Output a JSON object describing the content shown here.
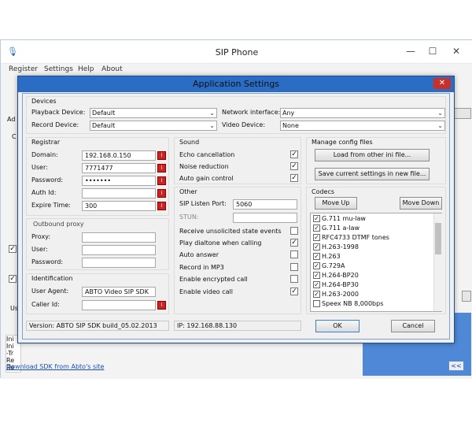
{
  "outer": {
    "title": "SIP Phone",
    "menu": [
      "Register",
      "Settings",
      "Help",
      "About"
    ],
    "min": "—",
    "max": "☐",
    "close": "✕",
    "left_fragments": [
      "Ad",
      "C",
      "Us",
      "Ini",
      "Ini",
      "-Tr",
      "Re",
      "Re"
    ],
    "download_link": "Download SDK from Abto's site",
    "collapse_btn": "<<"
  },
  "dialog": {
    "title": "Application Settings",
    "close": "✕",
    "devices": {
      "group": "Devices",
      "playback_label": "Playback Device:",
      "playback_value": "Default",
      "record_label": "Record Device:",
      "record_value": "Default",
      "network_label": "Network interface:",
      "network_value": "Any",
      "video_label": "Video Device:",
      "video_value": "None"
    },
    "registrar": {
      "group": "Registrar",
      "domain_label": "Domain:",
      "domain_value": "192.168.0.150",
      "user_label": "User:",
      "user_value": "7771477",
      "password_label": "Password:",
      "password_value": "•••••••",
      "authid_label": "Auth Id:",
      "authid_value": "",
      "expire_label": "Expire Time:",
      "expire_value": "300"
    },
    "outbound": {
      "group": "Outbound proxy",
      "proxy_label": "Proxy:",
      "user_label": "User:",
      "password_label": "Password:"
    },
    "identification": {
      "group": "Identification",
      "agent_label": "User Agent:",
      "agent_value": "ABTO Video SIP SDK",
      "callerid_label": "Caller Id:",
      "callerid_value": ""
    },
    "sound": {
      "group": "Sound",
      "items": [
        {
          "label": "Echo cancellation",
          "checked": "✓"
        },
        {
          "label": "Noise reduction",
          "checked": "✓"
        },
        {
          "label": "Auto gain control",
          "checked": "✓"
        }
      ]
    },
    "other": {
      "group": "Other",
      "port_label": "SIP Listen Port:",
      "port_value": "5060",
      "stun_label": "STUN:",
      "items": [
        {
          "label": "Receive unsolicited state events",
          "checked": ""
        },
        {
          "label": "Play dialtone when calling",
          "checked": "✓"
        },
        {
          "label": "Auto answer",
          "checked": ""
        },
        {
          "label": "Record in MP3",
          "checked": ""
        },
        {
          "label": "Enable encrypted call",
          "checked": ""
        },
        {
          "label": "Enable video call",
          "checked": "✓"
        }
      ]
    },
    "config": {
      "group": "Manage config files",
      "load_btn": "Load from other ini file...",
      "save_btn": "Save current settings in new file..."
    },
    "codecs": {
      "group": "Codecs",
      "move_up": "Move Up",
      "move_down": "Move Down",
      "items": [
        {
          "name": "G.711 mu-law",
          "checked": "✓"
        },
        {
          "name": "G.711 a-law",
          "checked": "✓"
        },
        {
          "name": "RFC4733 DTMF tones",
          "checked": "✓"
        },
        {
          "name": "H.263-1998",
          "checked": "✓"
        },
        {
          "name": "H.263",
          "checked": "✓"
        },
        {
          "name": "G.729A",
          "checked": "✓"
        },
        {
          "name": "H.264-BP20",
          "checked": "✓"
        },
        {
          "name": "H.264-BP30",
          "checked": "✓"
        },
        {
          "name": "H.263-2000",
          "checked": "✓"
        },
        {
          "name": "Speex NB   8,000bps",
          "checked": ""
        }
      ]
    },
    "ok_btn": "OK",
    "cancel_btn": "Cancel",
    "version": "Version: ABTO SIP SDK build_05.02.2013",
    "ip": "IP: 192.168.88.130"
  },
  "colors": {
    "title_bar": "#2b6cc4",
    "close": "#c8302a",
    "red_button": "#cc2222"
  }
}
